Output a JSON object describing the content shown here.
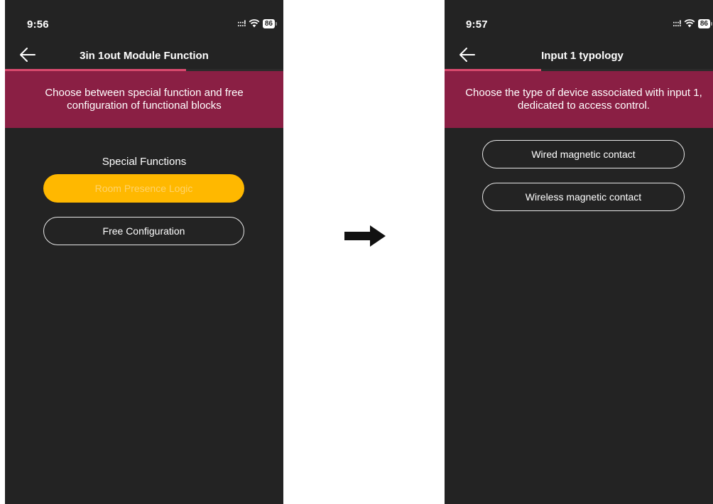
{
  "left_screen": {
    "status": {
      "time": "9:56",
      "signal": ":::!",
      "battery": "86"
    },
    "nav": {
      "title": "3in 1out Module Function"
    },
    "progress": 0.65,
    "banner_text": "Choose between special function and free configuration of functional blocks",
    "section_heading": "Special Functions",
    "options": [
      {
        "label": "Room Presence Logic",
        "selected": true
      },
      {
        "label": "Free Configuration",
        "selected": false
      }
    ]
  },
  "right_screen": {
    "status": {
      "time": "9:57",
      "signal": ":::!",
      "battery": "86"
    },
    "nav": {
      "title": "Input 1 typology"
    },
    "progress": 0.36,
    "banner_text": "Choose the type of device associated with input 1, dedicated to access control.",
    "options": [
      {
        "label": "Wired magnetic contact",
        "selected": false
      },
      {
        "label": "Wireless magnetic contact",
        "selected": false
      }
    ]
  },
  "colors": {
    "screen_bg": "#232323",
    "banner": "#8a1f44",
    "progress": "#d94a6e",
    "selected": "#ffb800"
  },
  "icons": {
    "transition": "right-arrow-icon",
    "back": "back-arrow-icon"
  }
}
